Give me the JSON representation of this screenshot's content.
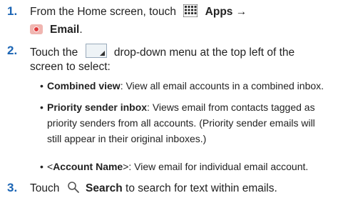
{
  "steps": [
    {
      "number": "1.",
      "pre": "From the Home screen, touch",
      "apps": "Apps",
      "arrow": "→",
      "email": "Email",
      "post": "."
    },
    {
      "number": "2.",
      "pre": "Touch the",
      "post": "drop-down menu at the top left of the",
      "cont": "screen to select:"
    },
    {
      "number": "3.",
      "pre": "Touch",
      "search": "Search",
      "post": "to search for text within emails."
    }
  ],
  "options": [
    {
      "term": "Combined view",
      "desc": ": View all email accounts in a combined inbox."
    },
    {
      "term": "Priority sender inbox",
      "desc": ": Views email from contacts tagged as",
      "cont1": "priority senders from all accounts. (Priority sender emails will",
      "cont2": "still appear in their original inboxes.)"
    },
    {
      "pre": "<",
      "term": "Account Name",
      "post": ">",
      "desc": ": View email for individual email account."
    }
  ],
  "bullet": "•"
}
